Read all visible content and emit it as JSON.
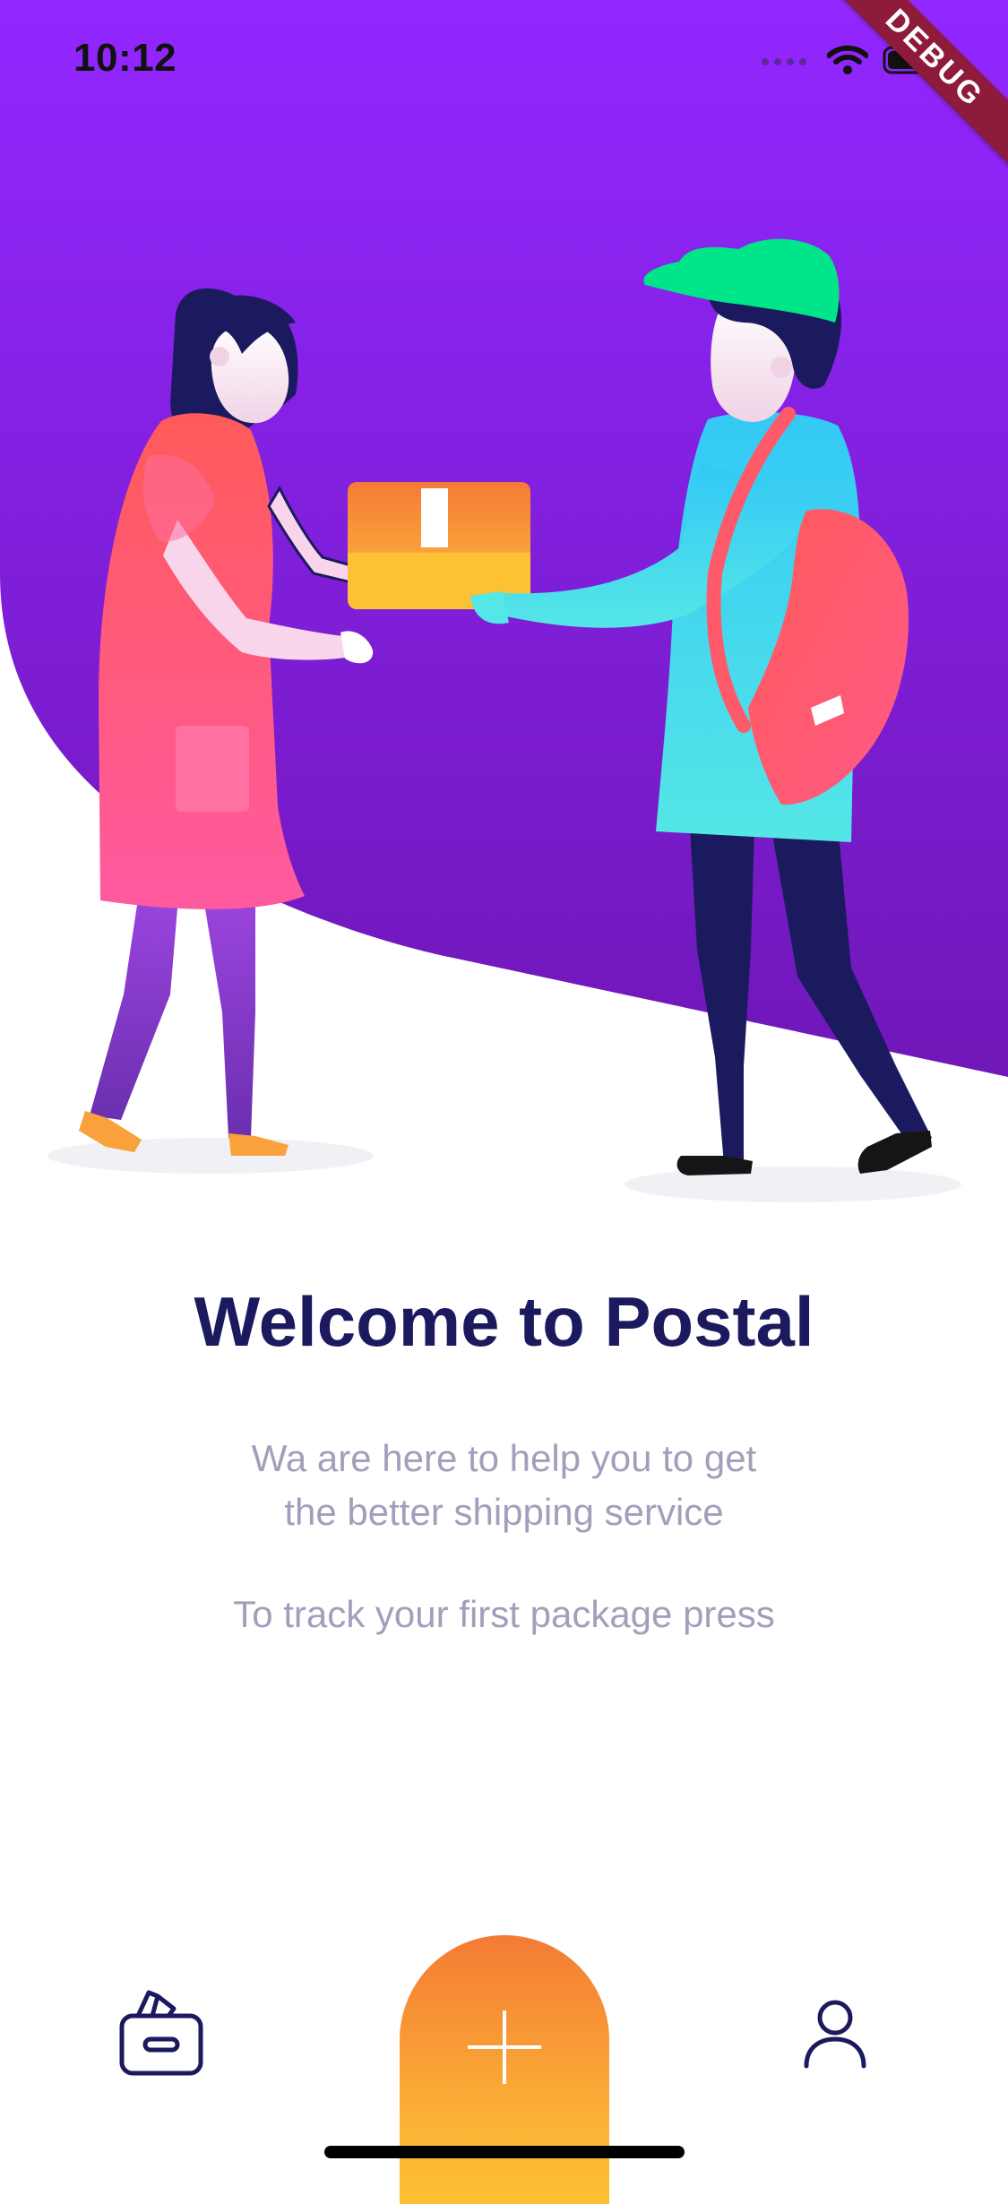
{
  "status_bar": {
    "time": "10:12",
    "icons": [
      "signal-icon",
      "wifi-icon",
      "battery-icon"
    ]
  },
  "debug_banner": {
    "label": "DEBUG"
  },
  "illustration": {
    "description_icon": "delivery-illustration",
    "colors": {
      "background_top": "#9227ff",
      "background_bottom": "#6f17b8",
      "cap": "#00e58a",
      "box": "#f47b35"
    }
  },
  "content": {
    "title": "Welcome to Postal",
    "subtitle_line1": "Wa are here to help you to get",
    "subtitle_line2": "the better shipping service",
    "subtitle_line3": "To track your first package press"
  },
  "bottom_nav": {
    "left_icon": "package-box-icon",
    "center_icon": "plus-icon",
    "right_icon": "user-icon",
    "colors": {
      "icon": "#1c1a5e",
      "fab_top": "#f47b35",
      "fab_bottom": "#fcc033"
    }
  }
}
